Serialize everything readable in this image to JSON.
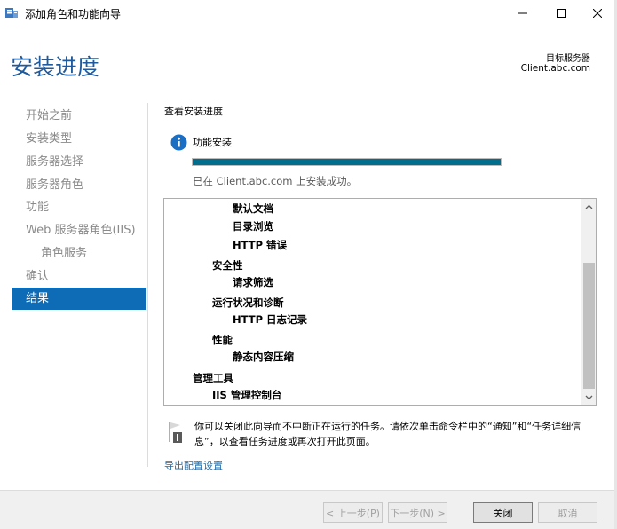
{
  "window": {
    "title": "添加角色和功能向导",
    "app_icon": "server-manager-icon",
    "controls": [
      "minimize-icon",
      "maximize-icon",
      "close-icon"
    ]
  },
  "header": {
    "title": "安装进度",
    "target_label": "目标服务器",
    "target_value": "Client.abc.com"
  },
  "nav": {
    "items": [
      {
        "label": "开始之前",
        "state": "done"
      },
      {
        "label": "安装类型",
        "state": "done"
      },
      {
        "label": "服务器选择",
        "state": "done"
      },
      {
        "label": "服务器角色",
        "state": "done"
      },
      {
        "label": "功能",
        "state": "done"
      },
      {
        "label": "Web 服务器角色(IIS)",
        "state": "done"
      },
      {
        "label": "角色服务",
        "state": "done"
      },
      {
        "label": "确认",
        "state": "done"
      },
      {
        "label": "结果",
        "state": "active"
      }
    ]
  },
  "main": {
    "section_title": "查看安装进度",
    "feature_label": "功能安装",
    "progress": 1.0,
    "progress_color": "#006e8c",
    "status_text": "已在 Client.abc.com 上安装成功。",
    "list_lines": [
      "默认文档",
      "目录浏览",
      "HTTP 错误",
      "安全性",
      "请求筛选",
      "运行状况和诊断",
      "HTTP 日志记录",
      "性能",
      "静态内容压缩",
      "管理工具",
      "IIS 管理控制台"
    ],
    "note_text": "你可以关闭此向导而不中断正在运行的任务。请依次单击命令栏中的“通知”和“任务详细信息”，以查看任务进度或再次打开此页面。",
    "export_link": "导出配置设置"
  },
  "footer": {
    "prev_label": "< 上一步(P)",
    "next_label": "下一步(N) >",
    "close_label": "关闭",
    "cancel_label": "取消"
  },
  "colors": {
    "accent": "#0e6bb5",
    "header_title": "#1e5a9e",
    "link": "#1e6ba8"
  }
}
